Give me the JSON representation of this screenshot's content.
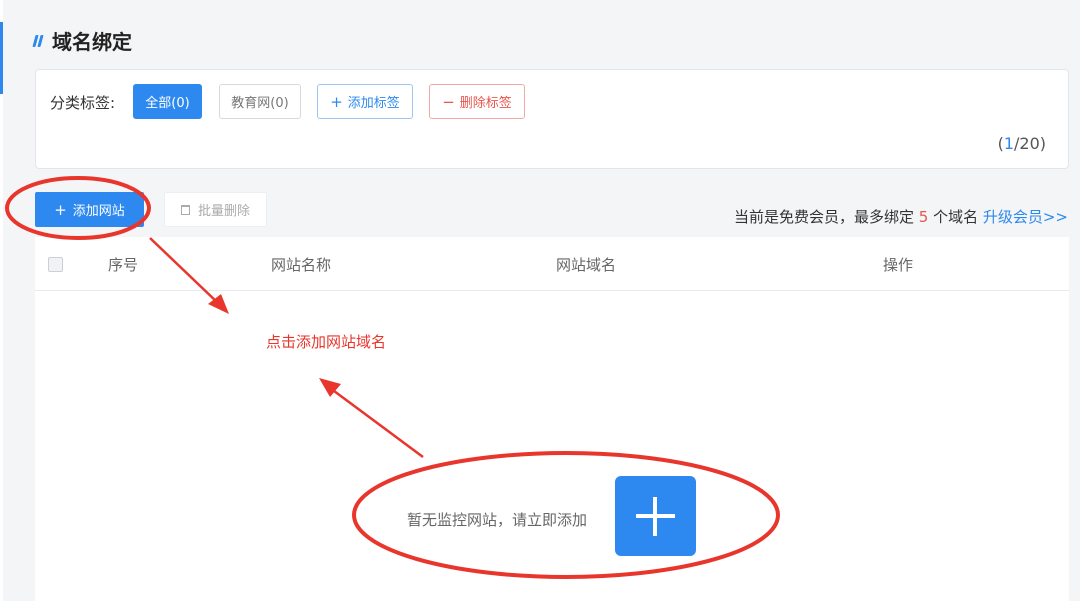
{
  "page": {
    "title": "域名绑定"
  },
  "tags": {
    "label": "分类标签:",
    "all": "全部(0)",
    "edu": "教育网(0)",
    "add": "添加标签",
    "add_symbol": "+",
    "delete": "删除标签",
    "delete_symbol": "−",
    "pager_open": "(",
    "pager_current": "1",
    "pager_rest": "/20)"
  },
  "toolbar": {
    "add_site": "添加网站",
    "add_symbol": "+",
    "batch_delete": "批量删除"
  },
  "membership": {
    "prefix": "当前是免费会员，最多绑定",
    "limit": "5",
    "suffix": "个域名",
    "upgrade": "升级会员>>"
  },
  "table": {
    "columns": [
      "序号",
      "网站名称",
      "网站域名",
      "操作"
    ]
  },
  "empty": {
    "text": "暂无监控网站，请立即添加"
  },
  "annotation": {
    "text": "点击添加网站域名",
    "color": "#e8362c"
  },
  "colors": {
    "accent": "#2d89ef",
    "danger": "#e9544d"
  }
}
